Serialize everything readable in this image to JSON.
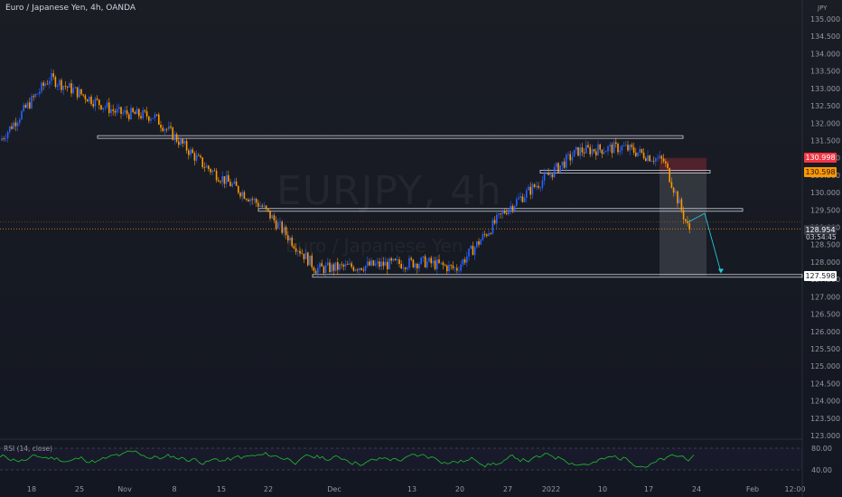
{
  "header": {
    "title": "Euro / Japanese Yen, 4h, OANDA"
  },
  "watermark": {
    "symbol": "EURJPY, 4h",
    "description": "Euro / Japanese Yen"
  },
  "axis": {
    "currency": "JPY"
  },
  "price_labels": {
    "stop": "130.998",
    "entry": "130.598",
    "current": "128.954",
    "countdown": "03:54:45",
    "target": "127.598"
  },
  "rsi": {
    "label": "RSI (14, close)",
    "ticks": [
      "80.00",
      "40.00"
    ]
  },
  "colors": {
    "up": "#2962ff",
    "down": "#ff9800",
    "rsi": "#1fbf2a",
    "stop": "#f23645",
    "entry": "#ff9800"
  },
  "chart_data": {
    "type": "line",
    "title": "Euro / Japanese Yen, 4h, OANDA",
    "y_ticks": [
      "135.000",
      "134.500",
      "134.000",
      "133.500",
      "133.000",
      "132.500",
      "132.000",
      "131.500",
      "131.000",
      "130.500",
      "130.000",
      "129.500",
      "129.000",
      "128.500",
      "128.000",
      "127.500",
      "127.000",
      "126.500",
      "126.000",
      "125.500",
      "125.000",
      "124.500",
      "124.000",
      "123.500",
      "123.000"
    ],
    "x_ticks": [
      "18",
      "25",
      "Nov",
      "8",
      "15",
      "22",
      "Dec",
      "13",
      "20",
      "27",
      "2022",
      "10",
      "17",
      "24",
      "Feb",
      "12:00"
    ],
    "ylim": [
      123.0,
      135.0
    ],
    "series": [
      {
        "x": [
          "18",
          "25",
          "Nov",
          "8",
          "15",
          "22",
          "Dec",
          "13",
          "20",
          "27",
          "2022",
          "10",
          "17",
          "24"
        ],
        "values": [
          131.5,
          133.3,
          132.3,
          132.2,
          130.8,
          129.6,
          127.8,
          128.0,
          127.8,
          129.5,
          131.2,
          131.3,
          130.9,
          128.95
        ]
      }
    ],
    "levels": [
      131.6,
      130.6,
      129.5,
      127.6
    ],
    "projection": [
      129.4,
      127.7
    ]
  }
}
